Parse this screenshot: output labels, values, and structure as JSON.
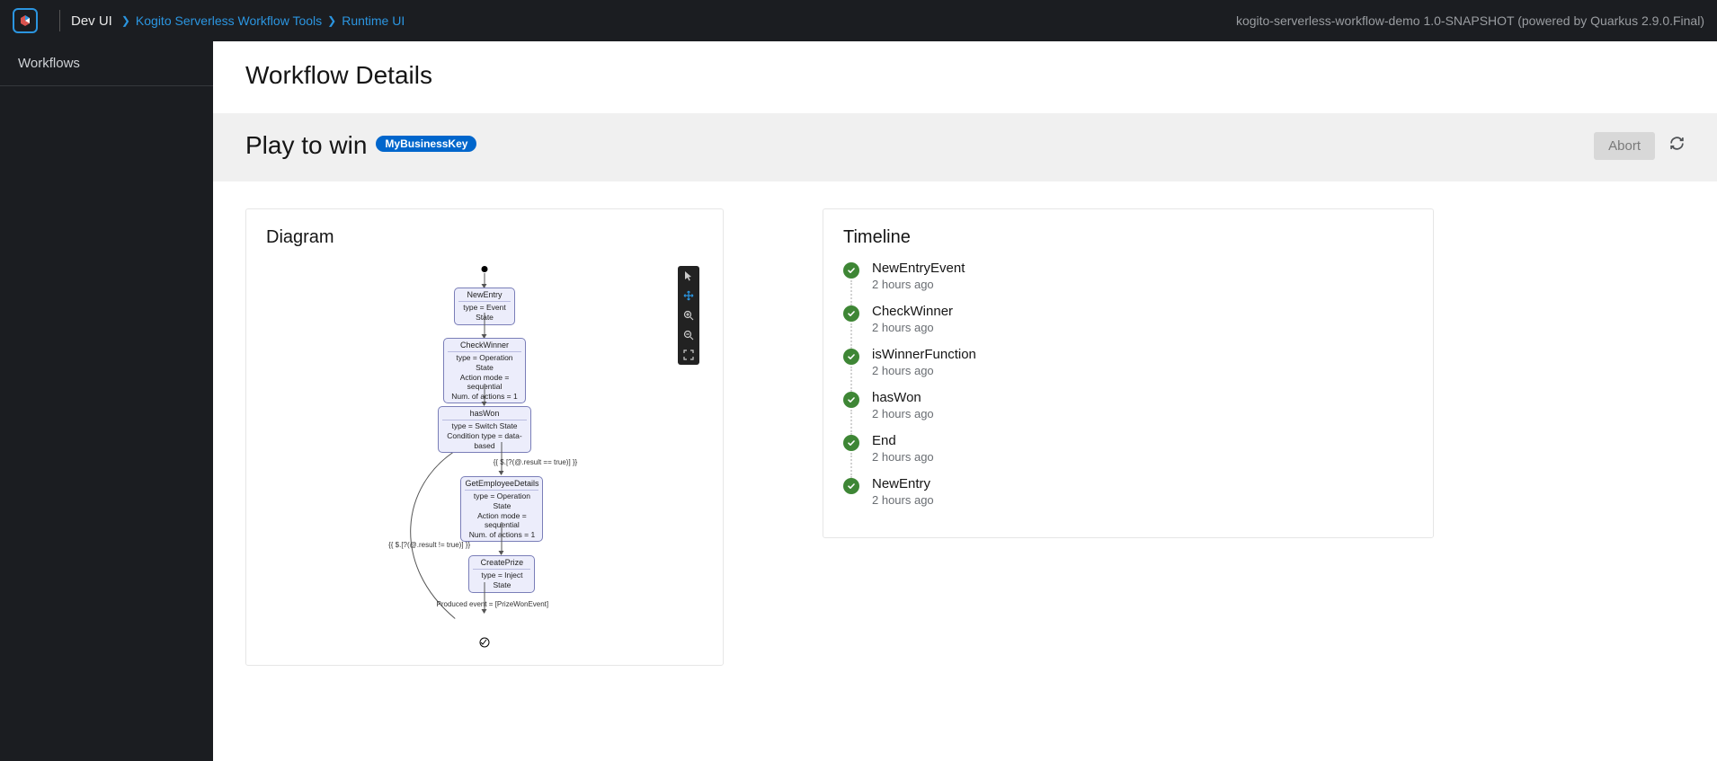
{
  "header": {
    "brand": "Dev UI",
    "breadcrumbs": [
      "Kogito Serverless Workflow Tools",
      "Runtime UI"
    ],
    "right_text": "kogito-serverless-workflow-demo 1.0-SNAPSHOT (powered by Quarkus 2.9.0.Final)"
  },
  "sidebar": {
    "items": [
      {
        "label": "Workflows"
      }
    ]
  },
  "page": {
    "title": "Workflow Details",
    "workflow_name": "Play to win",
    "business_key": "MyBusinessKey",
    "abort_label": "Abort"
  },
  "diagram": {
    "title": "Diagram",
    "nodes": [
      {
        "title": "NewEntry",
        "lines": [
          "type = Event State"
        ]
      },
      {
        "title": "CheckWinner",
        "lines": [
          "type = Operation State",
          "Action mode = sequential",
          "Num. of actions = 1"
        ]
      },
      {
        "title": "hasWon",
        "lines": [
          "type = Switch State",
          "Condition type = data-based"
        ]
      },
      {
        "title": "GetEmployeeDetails",
        "lines": [
          "type = Operation State",
          "Action mode = sequential",
          "Num. of actions = 1"
        ]
      },
      {
        "title": "CreatePrize",
        "lines": [
          "type = Inject State"
        ]
      }
    ],
    "edge_labels": {
      "true": "{{ $.[?(@.result == true)] }}",
      "false": "{{ $.[?(@.result != true)] }}",
      "produced": "Produced event = [PrizeWonEvent]"
    }
  },
  "timeline": {
    "title": "Timeline",
    "items": [
      {
        "name": "NewEntryEvent",
        "time": "2 hours ago"
      },
      {
        "name": "CheckWinner",
        "time": "2 hours ago"
      },
      {
        "name": "isWinnerFunction",
        "time": "2 hours ago"
      },
      {
        "name": "hasWon",
        "time": "2 hours ago"
      },
      {
        "name": "End",
        "time": "2 hours ago"
      },
      {
        "name": "NewEntry",
        "time": "2 hours ago"
      }
    ]
  }
}
